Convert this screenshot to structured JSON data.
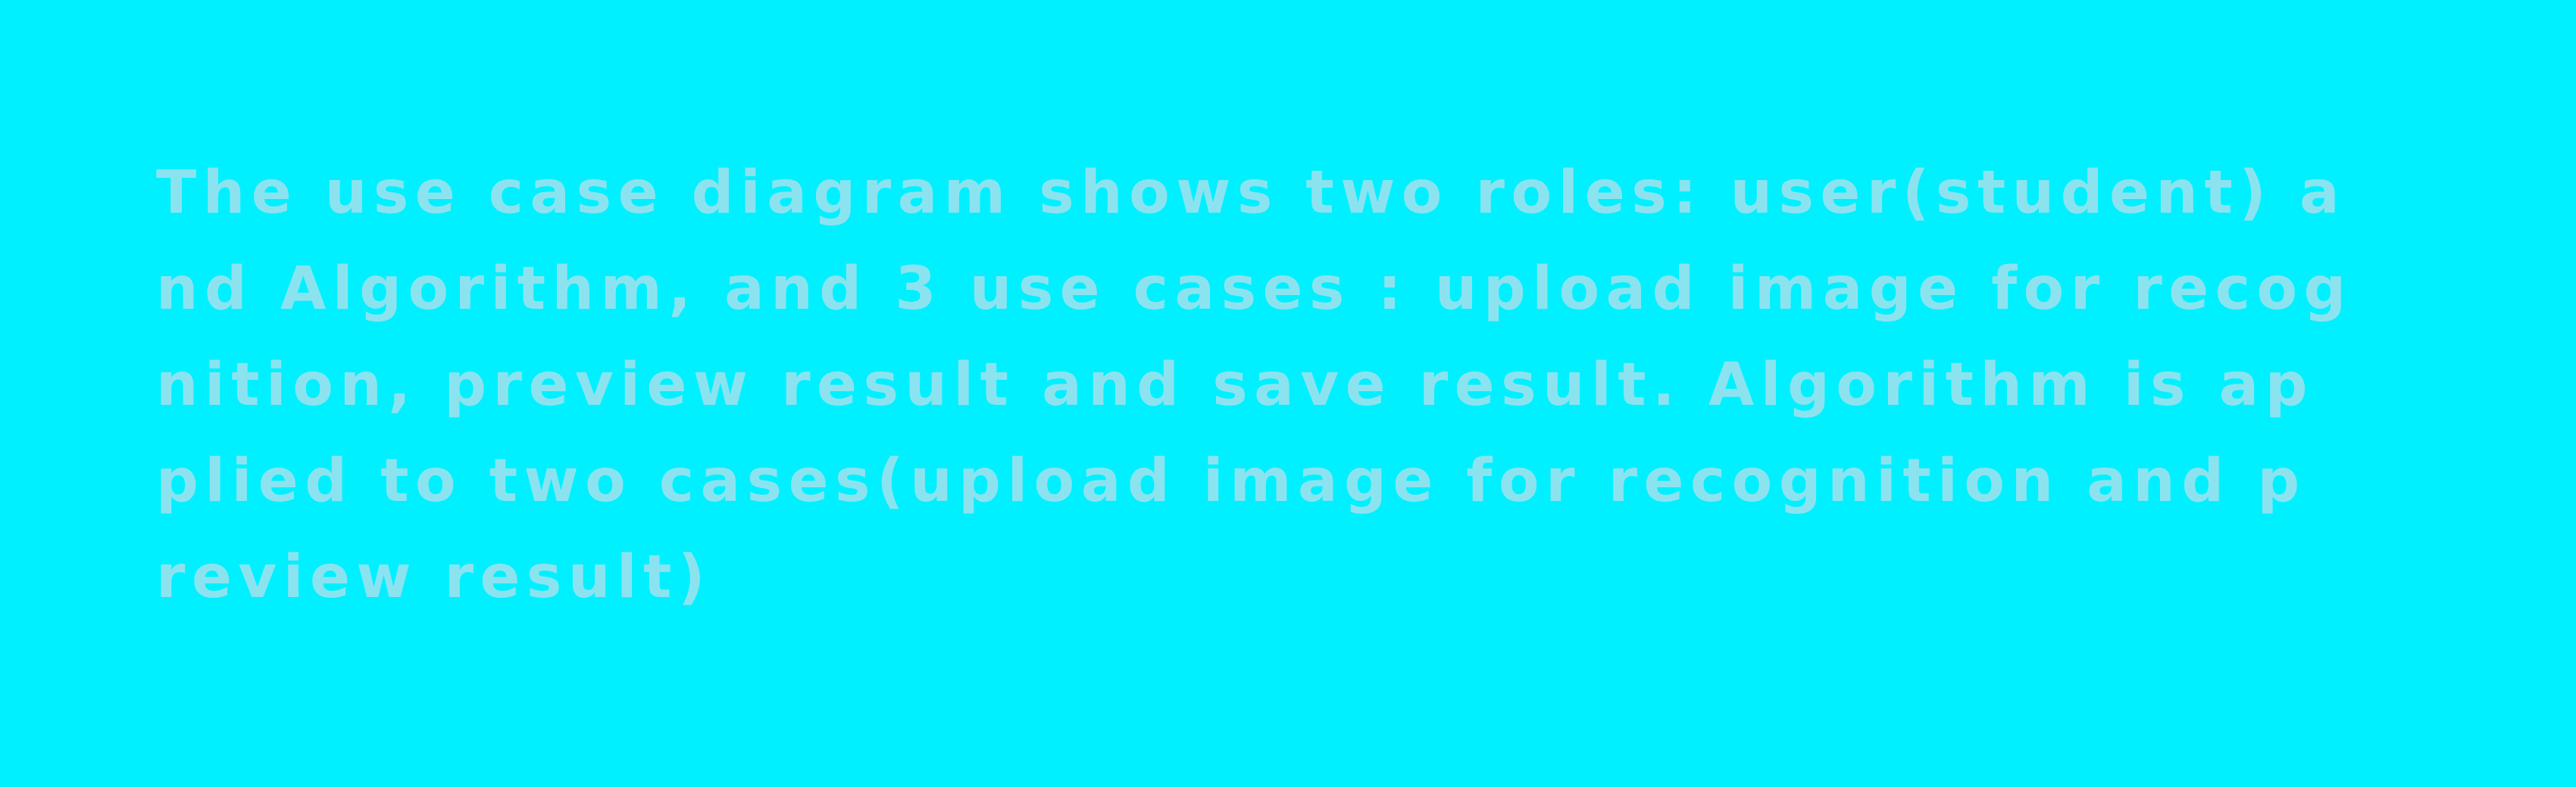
{
  "colors": {
    "background": "#00F0FF",
    "text": "#8CE3F0"
  },
  "description": {
    "lines": [
      "The use case diagram shows two roles: user(student) a",
      "nd Algorithm, and 3 use cases : upload image for recog",
      "nition, preview result and save result. Algorithm is ap",
      "plied to two cases(upload image for recognition and p",
      "review result)"
    ]
  }
}
